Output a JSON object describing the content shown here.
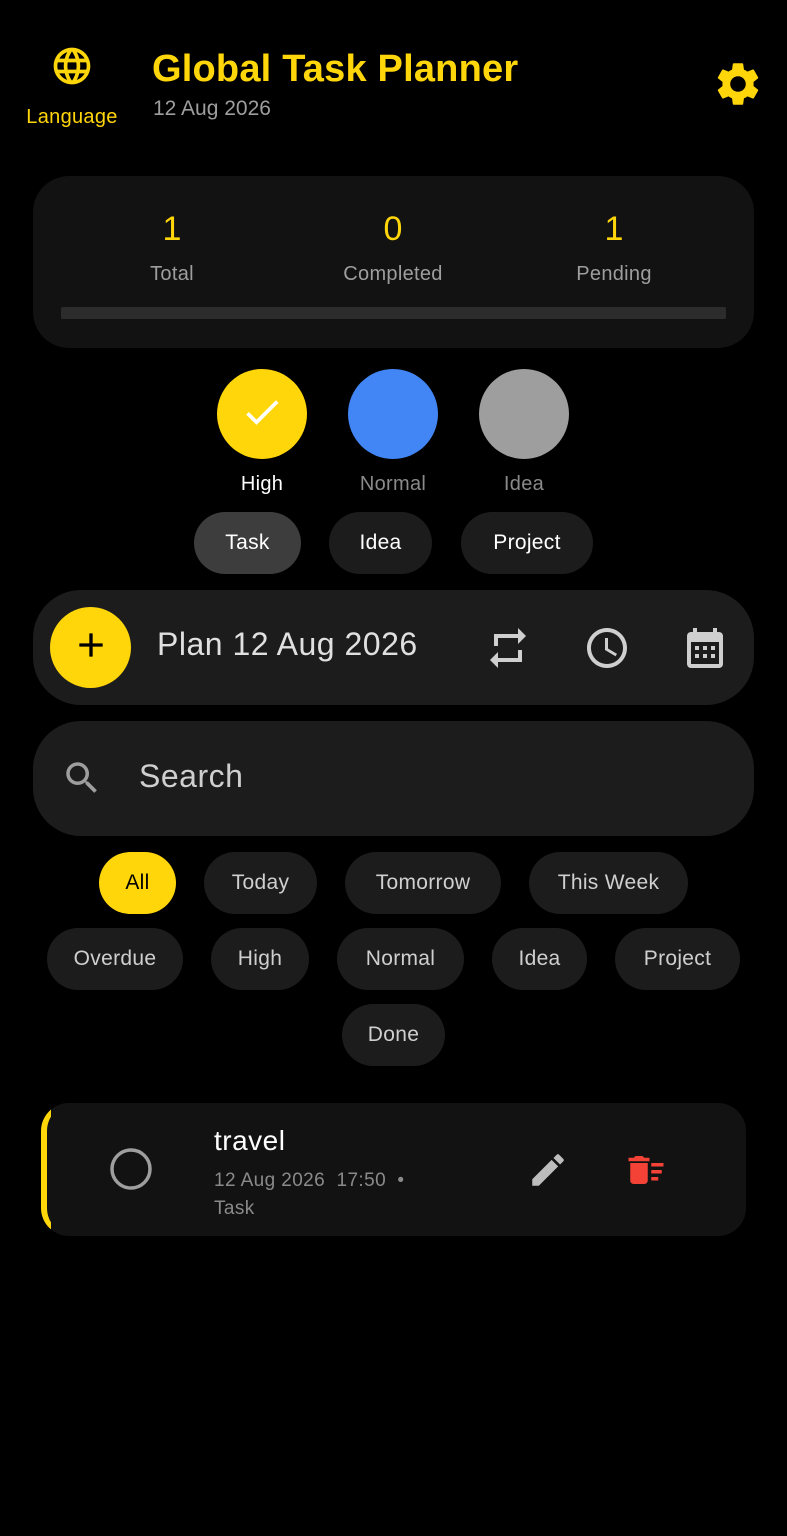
{
  "header": {
    "language_label": "Language",
    "language_icon": "globe-icon",
    "title": "Global Task Planner",
    "date": "12 Aug 2026",
    "settings_icon": "gear-icon"
  },
  "stats": {
    "total": {
      "value": "1",
      "label": "Total"
    },
    "completed": {
      "value": "0",
      "label": "Completed"
    },
    "pending": {
      "value": "1",
      "label": "Pending"
    },
    "progress_fraction": 0
  },
  "priorities": [
    {
      "label": "High",
      "color": "#FFD60A",
      "selected": true
    },
    {
      "label": "Normal",
      "color": "#4285F4",
      "selected": false
    },
    {
      "label": "Idea",
      "color": "#9E9E9E",
      "selected": false
    }
  ],
  "types": [
    {
      "label": "Task",
      "selected": true
    },
    {
      "label": "Idea",
      "selected": false
    },
    {
      "label": "Project",
      "selected": false
    }
  ],
  "plan": {
    "placeholder": "Plan 12 Aug 2026",
    "icons": [
      "repeat-icon",
      "clock-icon",
      "calendar-icon"
    ]
  },
  "search": {
    "placeholder": "Search"
  },
  "filters": [
    {
      "label": "All",
      "active": true
    },
    {
      "label": "Today",
      "active": false
    },
    {
      "label": "Tomorrow",
      "active": false
    },
    {
      "label": "This Week",
      "active": false
    },
    {
      "label": "Overdue",
      "active": false
    },
    {
      "label": "High",
      "active": false
    },
    {
      "label": "Normal",
      "active": false
    },
    {
      "label": "Idea",
      "active": false
    },
    {
      "label": "Project",
      "active": false
    },
    {
      "label": "Done",
      "active": false
    }
  ],
  "tasks": [
    {
      "title": "travel",
      "date": "12 Aug 2026",
      "time": "17:50",
      "separator": "•",
      "type": "Task",
      "done": false
    }
  ],
  "colors": {
    "accent": "#FFD60A",
    "background": "#000000",
    "card": "#121212",
    "surface": "#1C1C1C",
    "delete": "#F44336"
  }
}
